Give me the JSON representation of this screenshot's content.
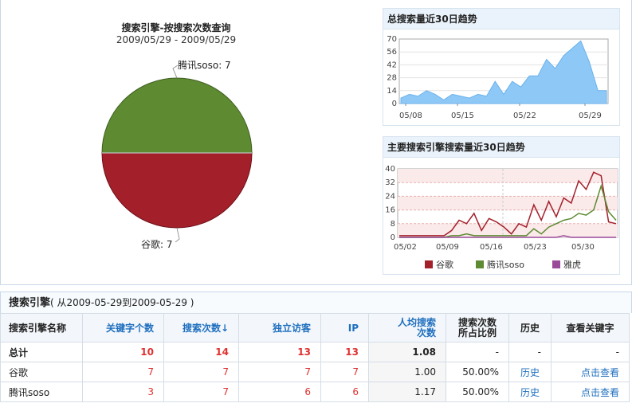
{
  "pie": {
    "title": "搜索引擎-按搜索次数查询",
    "subtitle": "2009/05/29 - 2009/05/29",
    "label_top": "腾讯soso: 7",
    "label_bottom": "谷歌: 7",
    "colors": {
      "top": "#5e8a32",
      "bottom": "#a3202a"
    }
  },
  "total_chart": {
    "title": "总搜索量近30日趋势",
    "y_ticks": [
      "0",
      "14",
      "28",
      "42",
      "56",
      "70"
    ],
    "x_ticks": [
      "05/08",
      "05/15",
      "05/22",
      "05/29"
    ]
  },
  "engine_chart": {
    "title": "主要搜索引擎搜索量近30日趋势",
    "y_ticks": [
      "0",
      "8",
      "16",
      "24",
      "32",
      "40"
    ],
    "x_ticks": [
      "05/02",
      "05/09",
      "05/16",
      "05/23",
      "05/30"
    ],
    "legend": [
      "谷歌",
      "腾讯soso",
      "雅虎"
    ]
  },
  "chart_data": [
    {
      "type": "pie",
      "title": "搜索引擎-按搜索次数查询",
      "subtitle": "2009/05/29 - 2009/05/29",
      "slices": [
        {
          "name": "腾讯soso",
          "value": 7,
          "color": "#5e8a32"
        },
        {
          "name": "谷歌",
          "value": 7,
          "color": "#a3202a"
        }
      ]
    },
    {
      "type": "area",
      "title": "总搜索量近30日趋势",
      "ylim": [
        0,
        70
      ],
      "x_ticks": [
        "05/08",
        "05/15",
        "05/22",
        "05/29"
      ],
      "values": [
        6,
        10,
        8,
        14,
        10,
        4,
        10,
        8,
        6,
        10,
        8,
        24,
        10,
        24,
        18,
        30,
        30,
        48,
        38,
        52,
        60,
        68,
        45,
        14,
        14
      ]
    },
    {
      "type": "line",
      "title": "主要搜索引擎搜索量近30日趋势",
      "ylim": [
        0,
        40
      ],
      "x_ticks": [
        "05/02",
        "05/09",
        "05/16",
        "05/23",
        "05/30"
      ],
      "series": [
        {
          "name": "谷歌",
          "color": "#a3202a",
          "values": [
            1,
            1,
            1,
            1,
            1,
            1,
            1,
            4,
            10,
            8,
            14,
            4,
            11,
            9,
            6,
            2,
            8,
            6,
            19,
            10,
            21,
            12,
            23,
            20,
            33,
            28,
            38,
            36,
            9,
            8
          ]
        },
        {
          "name": "腾讯soso",
          "color": "#5e8a32",
          "values": [
            0,
            0,
            0,
            0,
            0,
            0,
            0,
            1,
            1,
            2,
            1,
            1,
            1,
            1,
            1,
            1,
            1,
            1,
            5,
            2,
            6,
            8,
            10,
            11,
            14,
            13,
            16,
            30,
            15,
            10
          ]
        },
        {
          "name": "雅虎",
          "color": "#9a4a9a",
          "values": [
            0,
            0,
            0,
            0,
            0,
            0,
            0,
            0,
            0,
            0,
            0,
            0,
            0,
            0,
            0,
            0,
            0,
            0,
            0,
            0,
            0,
            0,
            1,
            0,
            0,
            0,
            0,
            0,
            0,
            0
          ]
        }
      ]
    }
  ],
  "table": {
    "title": "搜索引擎",
    "range": "( 从2009-05-29到2009-05-29 )",
    "headers": {
      "name": "搜索引擎名称",
      "keywords": "关键字个数",
      "searches": "搜索次数↓",
      "visitors": "独立访客",
      "ip": "IP",
      "per_person_1": "人均搜索",
      "per_person_2": "次数",
      "ratio_1": "搜索次数",
      "ratio_2": "所占比例",
      "history": "历史",
      "view_kw": "查看关键字"
    },
    "rows": [
      {
        "name": "总计",
        "keywords": "10",
        "searches": "14",
        "visitors": "13",
        "ip": "13",
        "per": "1.08",
        "ratio": "-",
        "history": "-",
        "view": "-"
      },
      {
        "name": "谷歌",
        "keywords": "7",
        "searches": "7",
        "visitors": "7",
        "ip": "7",
        "per": "1.00",
        "ratio": "50.00%",
        "history": "历史",
        "view": "点击查看"
      },
      {
        "name": "腾讯soso",
        "keywords": "3",
        "searches": "7",
        "visitors": "6",
        "ip": "6",
        "per": "1.17",
        "ratio": "50.00%",
        "history": "历史",
        "view": "点击查看"
      }
    ]
  }
}
